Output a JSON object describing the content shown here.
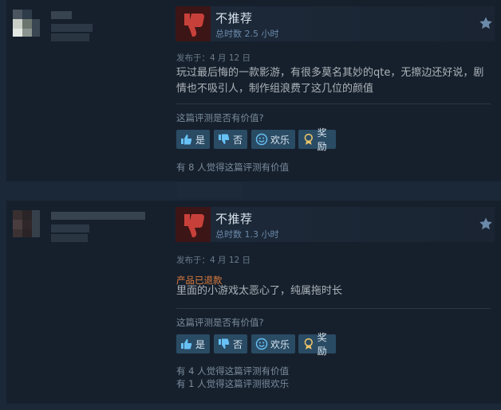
{
  "reviews": [
    {
      "verdict": "不推荐",
      "hours": "总时数 2.5 小时",
      "posted": "发布于：4 月 12 日",
      "refund": "",
      "text_lines": [
        "玩过最后悔的一款影游，有很多莫名其妙的qte，无擦边还好说，剧",
        "情也不吸引人，制作组浪费了这几位的颜值"
      ],
      "helpful_question": "这篇评测是否有价值?",
      "buttons": {
        "yes": "是",
        "no": "否",
        "funny": "欢乐",
        "award": "奖励"
      },
      "tallies": [
        "有 8 人觉得这篇评测有价值"
      ]
    },
    {
      "verdict": "不推荐",
      "hours": "总时数 1.3 小时",
      "posted": "发布于：4 月 12 日",
      "refund": "产品已退款",
      "text_lines": [
        "里面的小游戏太恶心了，纯属拖时长"
      ],
      "helpful_question": "这篇评测是否有价值?",
      "buttons": {
        "yes": "是",
        "no": "否",
        "funny": "欢乐",
        "award": "奖励"
      },
      "tallies": [
        "有 4 人觉得这篇评测有价值",
        "有 1 人觉得这篇评测很欢乐"
      ]
    }
  ],
  "icons": {
    "thumb": "thumbs-down-icon",
    "star": "star-icon",
    "yes": "thumbs-up-icon",
    "no": "thumbs-down-icon",
    "funny": "smiley-icon",
    "award": "award-icon"
  },
  "colors": {
    "background": "#1b2838",
    "panel": "#16202d",
    "thumb_box": "#3c1516",
    "thumb_icon": "#c8403a",
    "button": "#2a4b64",
    "refund": "#e07e3d"
  }
}
